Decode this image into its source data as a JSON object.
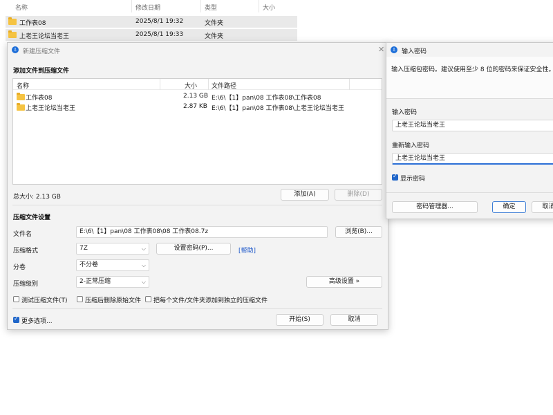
{
  "explorer": {
    "columns": [
      "名称",
      "修改日期",
      "类型",
      "大小"
    ],
    "rows": [
      {
        "name": "工作表08",
        "date": "2025/8/1 19:32",
        "type": "文件夹"
      },
      {
        "name": "上老王论坛当老王",
        "date": "2025/8/1 19:33",
        "type": "文件夹"
      }
    ]
  },
  "compress_dialog": {
    "title": "新建压缩文件",
    "add_section": "添加文件到压缩文件",
    "list_columns": {
      "name": "名称",
      "size": "大小",
      "path": "文件路径"
    },
    "files": [
      {
        "name": "工作表08",
        "size": "2.13 GB",
        "path": "E:\\6\\【1】pan\\08 工作表08\\工作表08"
      },
      {
        "name": "上老王论坛当老王",
        "size": "2.87 KB",
        "path": "E:\\6\\【1】pan\\08 工作表08\\上老王论坛当老王"
      }
    ],
    "total_size": "总大小: 2.13 GB",
    "add_button": "添加(A)",
    "delete_button": "删除(D)",
    "settings_section": "压缩文件设置",
    "filename_label": "文件名",
    "filename_value": "E:\\6\\【1】pan\\08 工作表08\\08 工作表08.7z",
    "browse_button": "浏览(B)...",
    "format_label": "压缩格式",
    "format_value": "7Z",
    "set_password_button": "设置密码(P)...",
    "help_link": "[帮助]",
    "split_label": "分卷",
    "split_value": "不分卷",
    "level_label": "压缩级别",
    "level_value": "2-正常压缩",
    "advanced_button": "高级设置 »",
    "test_checkbox": "测试压缩文件(T)",
    "delete_after_checkbox": "压缩后删除原始文件",
    "separate_checkbox": "把每个文件/文件夹添加到独立的压缩文件",
    "more_options": "更多选项...",
    "start_button": "开始(S)",
    "cancel_button": "取消"
  },
  "password_dialog": {
    "title": "输入密码",
    "hint": "输入压缩包密码。建议使用至少 8 位的密码来保证安全性。",
    "password_label": "输入密码",
    "password_value": "上老王论坛当老王",
    "confirm_label": "重新输入密码",
    "confirm_value": "上老王论坛当老王",
    "show_password": "显示密码",
    "manager_button": "密码管理器...",
    "ok_button": "确定",
    "cancel_button": "取消"
  },
  "colors": {
    "accent": "#2066c9",
    "folder": "#f5c342"
  }
}
